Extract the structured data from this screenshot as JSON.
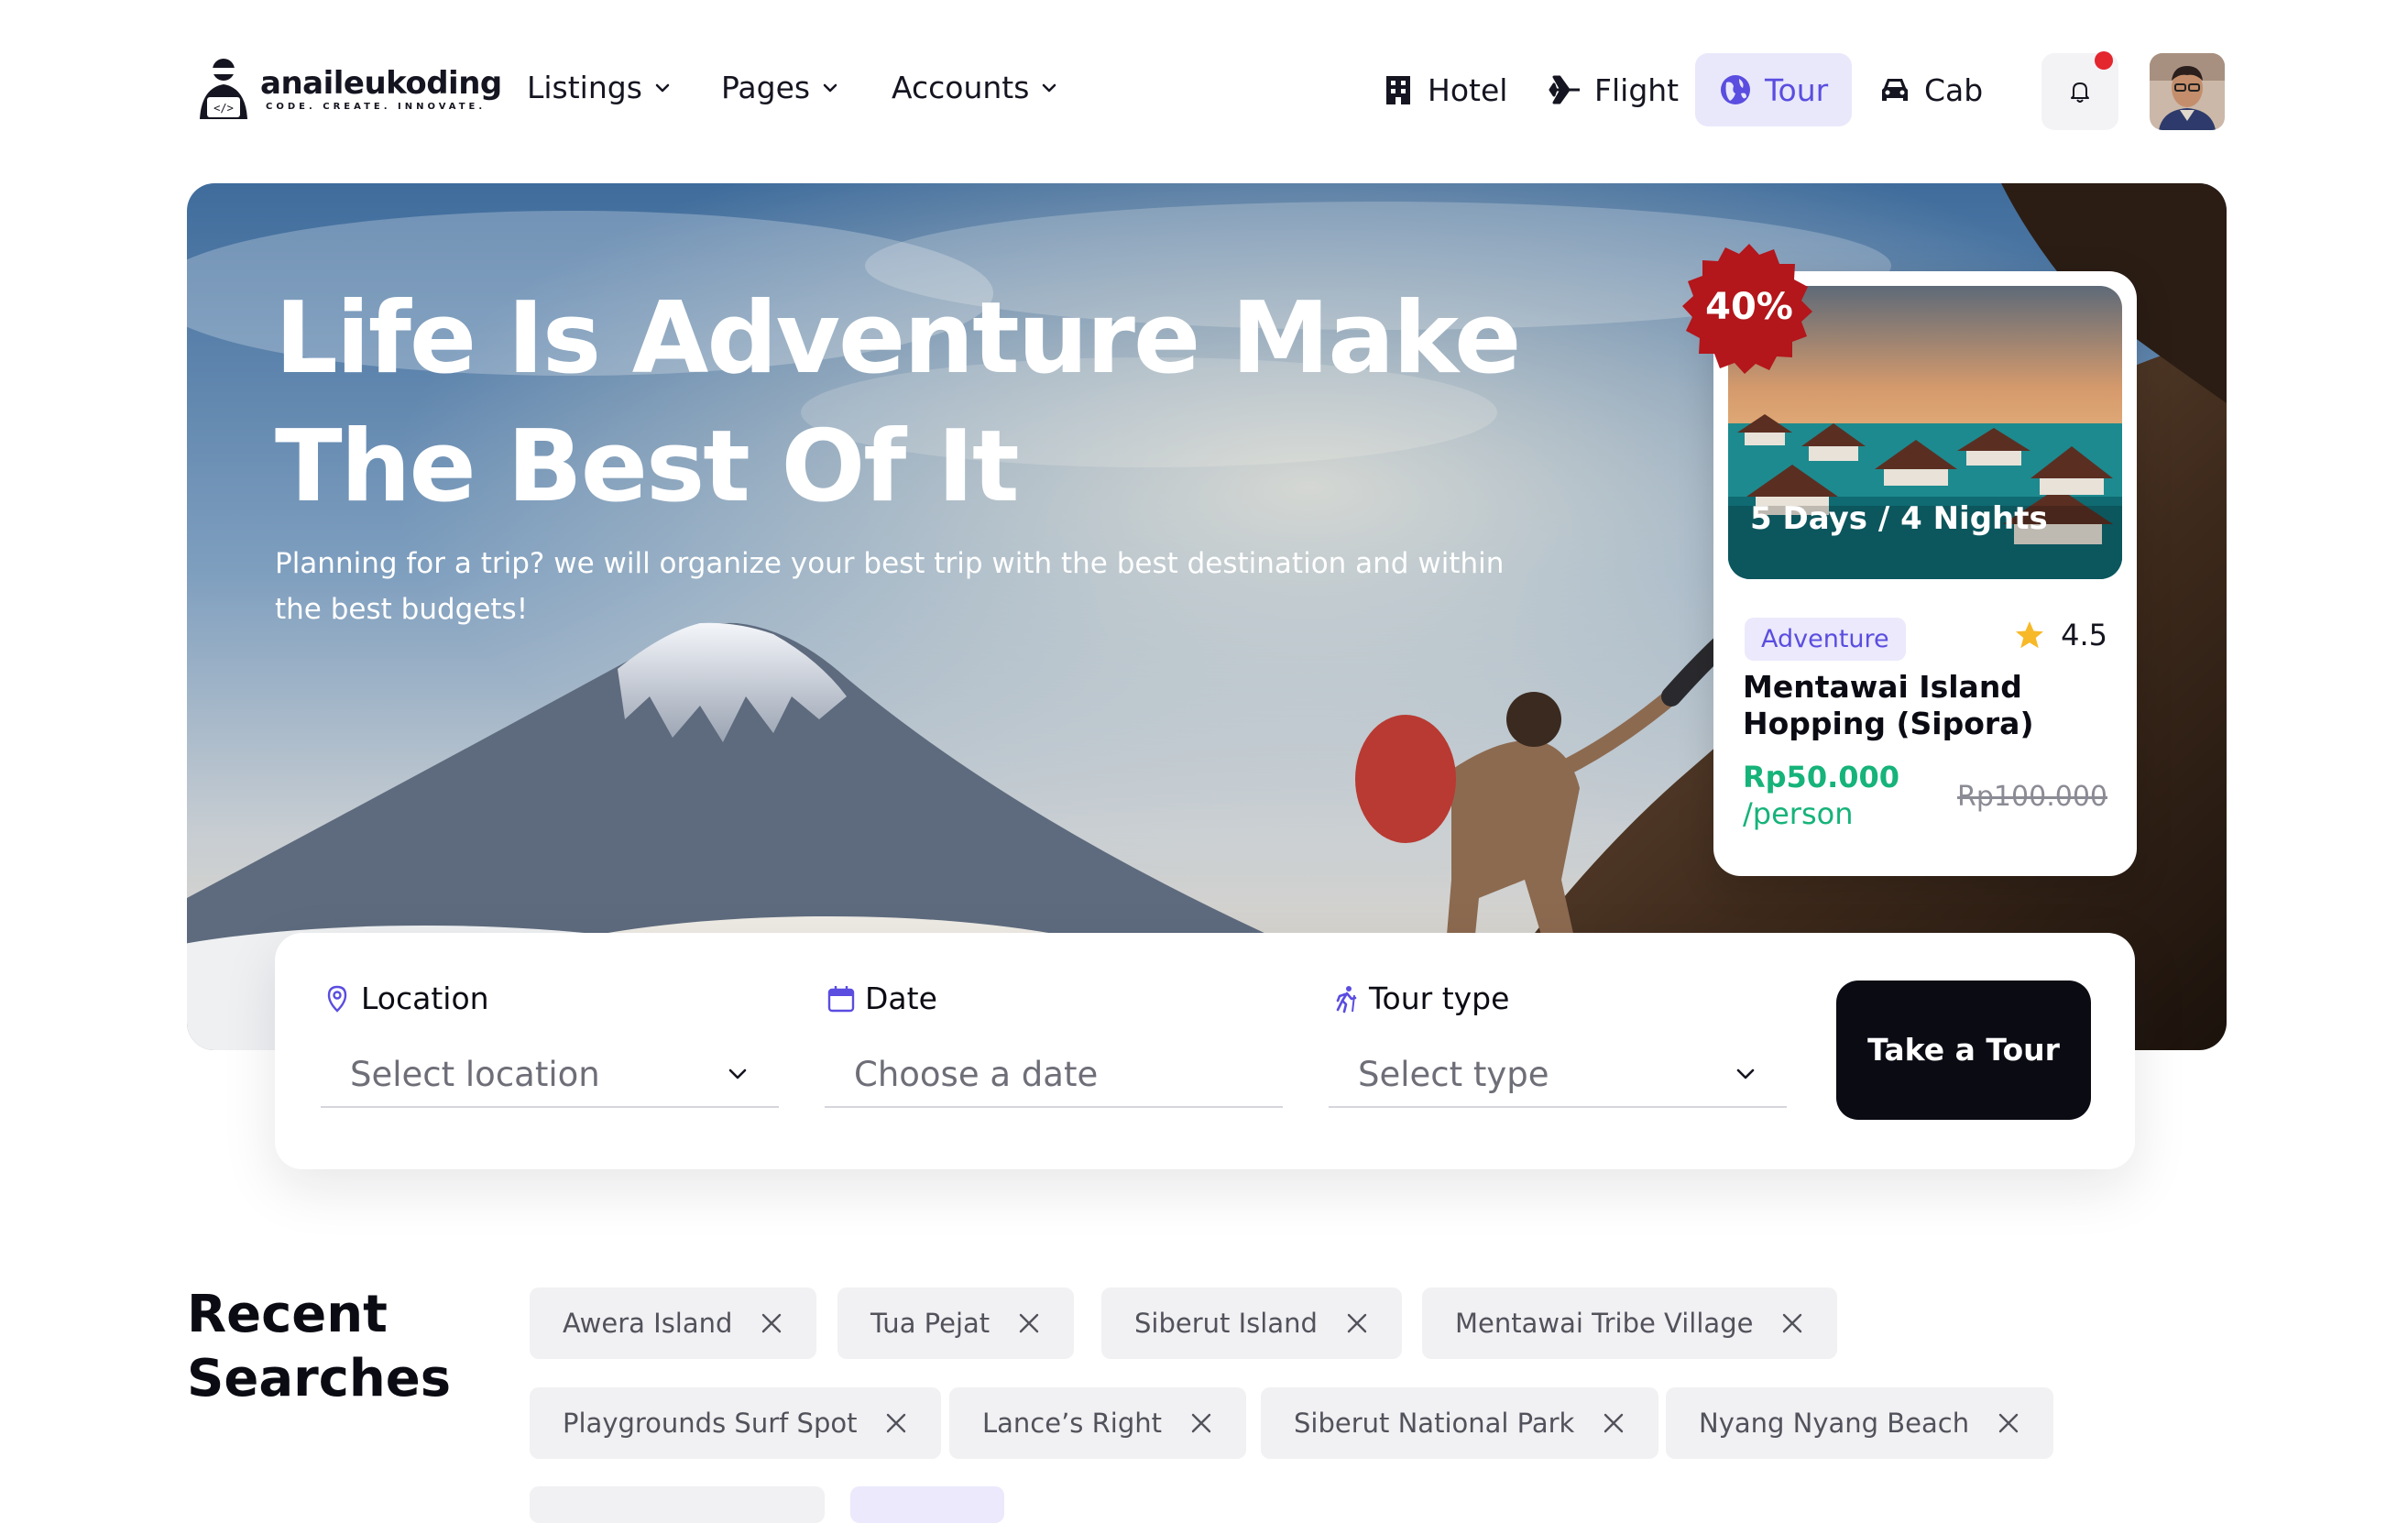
{
  "brand": {
    "name": "anaileukoding",
    "tagline": "CODE. CREATE. INNOVATE."
  },
  "nav": {
    "menus": [
      "Listings",
      "Pages",
      "Accounts"
    ],
    "services": [
      {
        "label": "Hotel",
        "icon": "building-icon"
      },
      {
        "label": "Flight",
        "icon": "plane-icon"
      },
      {
        "label": "Tour",
        "icon": "globe-icon",
        "active": true
      },
      {
        "label": "Cab",
        "icon": "car-icon"
      }
    ],
    "notification_icon": "bell-icon",
    "notification_dot_color": "#e4262f"
  },
  "hero": {
    "title": "Life Is Adventure Make The Best Of It",
    "subtitle": "Planning for a trip? we will organize your best trip with the best destination and within the best budgets!"
  },
  "promo": {
    "discount": "40%",
    "duration": "5 Days / 4 Nights",
    "category": "Adventure",
    "rating": "4.5",
    "title": "Mentawai Island Hopping (Sipora)",
    "price": "Rp50.000",
    "price_unit": "/person",
    "old_price": "Rp100.000"
  },
  "search": {
    "location": {
      "label": "Location",
      "placeholder": "Select location",
      "icon": "map-pin-icon"
    },
    "date": {
      "label": "Date",
      "placeholder": "Choose a date",
      "icon": "calendar-icon"
    },
    "tour_type": {
      "label": "Tour type",
      "placeholder": "Select type",
      "icon": "hiker-icon"
    },
    "submit": "Take a Tour"
  },
  "recent": {
    "title": "Recent Searches",
    "chips": [
      "Awera Island",
      "Tua Pejat",
      "Siberut Island",
      "Mentawai Tribe Village",
      "Playgrounds Surf Spot",
      "Lance’s Right",
      "Siberut National Park",
      "Nyang Nyang Beach"
    ]
  },
  "colors": {
    "accent": "#5a4de0",
    "price": "#16b37a",
    "dark": "#0b0b14",
    "discount": "#b3161b"
  }
}
